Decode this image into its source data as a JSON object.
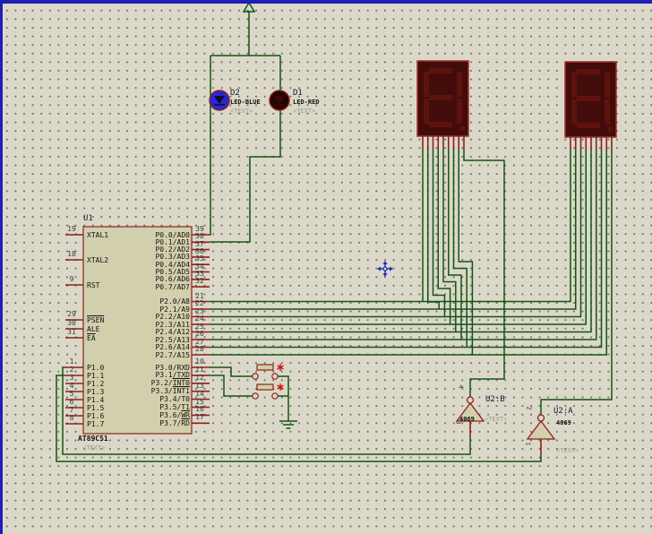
{
  "sheet": {
    "border_color": "#1f1fb4",
    "background": "#dbd8c9"
  },
  "colors": {
    "wire": "#135513",
    "component": "#8e201c",
    "fill": "#d2cfad",
    "seg_body": "#420c0a",
    "seg_on": "#5c130c",
    "seg_border": "#a03028",
    "star": "#cc1111",
    "cursor": "#1d2bc0"
  },
  "chip": {
    "ref": "U1",
    "value": "AT89C51",
    "placeholder": "<TEXT>",
    "left_pins": [
      {
        "num": "19",
        "name": "XTAL1"
      },
      {
        "num": "18",
        "name": "XTAL2"
      },
      {
        "num": "9",
        "name": "RST"
      },
      {
        "num": "29",
        "name": "",
        "bar": "PSEN"
      },
      {
        "num": "30",
        "name": "ALE"
      },
      {
        "num": "31",
        "name": "",
        "bar": "EA"
      },
      {
        "num": "1",
        "name": "P1.0"
      },
      {
        "num": "2",
        "name": "P1.1"
      },
      {
        "num": "3",
        "name": "P1.2"
      },
      {
        "num": "4",
        "name": "P1.3"
      },
      {
        "num": "5",
        "name": "P1.4"
      },
      {
        "num": "6",
        "name": "P1.5"
      },
      {
        "num": "7",
        "name": "P1.6"
      },
      {
        "num": "8",
        "name": "P1.7"
      }
    ],
    "right_pins": [
      {
        "num": "39",
        "name": "P0.0/AD0"
      },
      {
        "num": "38",
        "name": "P0.1/AD1"
      },
      {
        "num": "37",
        "name": "P0.2/AD2"
      },
      {
        "num": "36",
        "name": "P0.3/AD3"
      },
      {
        "num": "35",
        "name": "P0.4/AD4"
      },
      {
        "num": "34",
        "name": "P0.5/AD5"
      },
      {
        "num": "33",
        "name": "P0.6/AD6"
      },
      {
        "num": "32",
        "name": "P0.7/AD7"
      },
      {
        "num": "21",
        "name": "P2.0/A8"
      },
      {
        "num": "22",
        "name": "P2.1/A9"
      },
      {
        "num": "23",
        "name": "P2.2/A10"
      },
      {
        "num": "24",
        "name": "P2.3/A11"
      },
      {
        "num": "25",
        "name": "P2.4/A12"
      },
      {
        "num": "26",
        "name": "P2.5/A13"
      },
      {
        "num": "27",
        "name": "P2.6/A14"
      },
      {
        "num": "28",
        "name": "P2.7/A15"
      },
      {
        "num": "10",
        "name": "P3.0/RXD"
      },
      {
        "num": "11",
        "name": "P3.1/TXD"
      },
      {
        "num": "12",
        "name": "P3.2/",
        "bar": "INT0"
      },
      {
        "num": "13",
        "name": "P3.3/",
        "bar": "INT1"
      },
      {
        "num": "14",
        "name": "P3.4/T0"
      },
      {
        "num": "15",
        "name": "P3.5/T1"
      },
      {
        "num": "16",
        "name": "P3.6/",
        "bar": "WR"
      },
      {
        "num": "17",
        "name": "P3.7/",
        "bar": "RD"
      }
    ]
  },
  "leds": [
    {
      "ref": "D2",
      "value": "LED-BLUE",
      "placeholder": "<TEXT>",
      "color": "#2628d8",
      "symbol": "#0d0d2e"
    },
    {
      "ref": "D1",
      "value": "LED-RED",
      "placeholder": "<TEXT>",
      "color": "#230403",
      "symbol": "#3a0808"
    }
  ],
  "inverters": [
    {
      "ref": "U2:B",
      "value": "4069",
      "placeholder": "<TEXT>",
      "pin_out": "4",
      "pin_in": "3"
    },
    {
      "ref": "U2:A",
      "value": "4069",
      "placeholder": "<TEXT>",
      "pin_out": "2",
      "pin_in": "1"
    }
  ]
}
